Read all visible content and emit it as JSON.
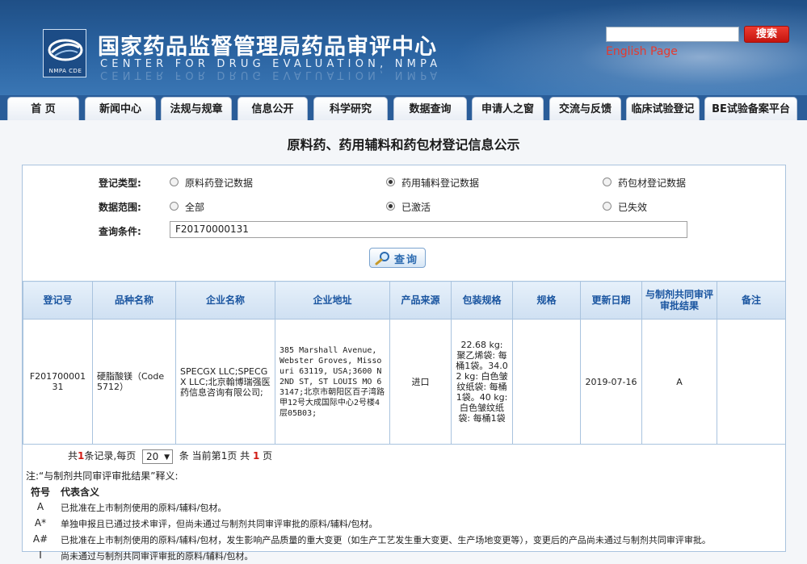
{
  "header": {
    "title_cn": "国家药品监督管理局药品审评中心",
    "title_en": "CENTER FOR DRUG EVALUATION, NMPA",
    "logo_text": "NMPA CDE",
    "search_placeholder": "",
    "search_button": "搜索",
    "english_link": "English Page"
  },
  "nav": {
    "items": [
      {
        "label": "首  页"
      },
      {
        "label": "新闻中心"
      },
      {
        "label": "法规与规章"
      },
      {
        "label": "信息公开"
      },
      {
        "label": "科学研究"
      },
      {
        "label": "数据查询"
      },
      {
        "label": "申请人之窗"
      },
      {
        "label": "交流与反馈"
      },
      {
        "label": "临床试验登记"
      },
      {
        "label": "BE试验备案平台"
      }
    ]
  },
  "page_title": "原料药、药用辅料和药包材登记信息公示",
  "form": {
    "type_label": "登记类型:",
    "type_options": [
      {
        "label": "原料药登记数据",
        "checked": false
      },
      {
        "label": "药用辅料登记数据",
        "checked": true
      },
      {
        "label": "药包材登记数据",
        "checked": false
      }
    ],
    "scope_label": "数据范围:",
    "scope_options": [
      {
        "label": "全部",
        "checked": false
      },
      {
        "label": "已激活",
        "checked": true
      },
      {
        "label": "已失效",
        "checked": false
      }
    ],
    "query_label": "查询条件:",
    "query_value": "F20170000131",
    "query_button": "查询"
  },
  "table": {
    "headers": [
      "登记号",
      "品种名称",
      "企业名称",
      "企业地址",
      "产品来源",
      "包装规格",
      "规格",
      "更新日期",
      "与制剂共同审评审批结果",
      "备注"
    ],
    "rows": [
      {
        "reg_no": "F20170000131",
        "product": "硬脂酸镁（Code 5712）",
        "company": "SPECGX LLC;SPECGX LLC;北京翰博瑞强医药信息咨询有限公司;",
        "address": "385 Marshall Avenue, Webster Groves, Missouri 63119, USA;3600 N 2ND ST, ST LOUIS MO 63147;北京市朝阳区百子湾路甲12号大成国际中心2号楼4层05B03;",
        "source": "进口",
        "package": "22.68 kg: 聚乙烯袋: 每桶1袋。34.02 kg: 白色皱纹纸袋: 每桶1袋。40 kg: 白色皱纹纸袋: 每桶1袋",
        "spec": "",
        "updated": "2019-07-16",
        "result": "A",
        "remark": ""
      }
    ]
  },
  "pager": {
    "prefix": "共",
    "total": "1",
    "mid1": "条记录,每页",
    "per_page": "20",
    "mid2": "条 当前第",
    "current": "1",
    "mid3": "页 共",
    "pages": "1",
    "suffix": "页"
  },
  "notes": {
    "title": "注:“与制剂共同审评审批结果”释义:",
    "col_code": "符号",
    "col_meaning": "代表含义",
    "items": [
      {
        "code": "A",
        "text": "已批准在上市制剂使用的原料/辅料/包材。"
      },
      {
        "code": "A*",
        "text": "单独申报且已通过技术审评，但尚未通过与制剂共同审评审批的原料/辅料/包材。"
      },
      {
        "code": "A#",
        "text": "已批准在上市制剂使用的原料/辅料/包材，发生影响产品质量的重大变更（如生产工艺发生重大变更、生产场地变更等），变更后的产品尚未通过与制剂共同审评审批。"
      },
      {
        "code": "I",
        "text": "尚未通过与制剂共同审评审批的原料/辅料/包材。"
      }
    ]
  },
  "colors": {
    "header_blue": "#2b64a2",
    "table_header_text": "#1a55a0",
    "accent_red": "#d11b14"
  }
}
